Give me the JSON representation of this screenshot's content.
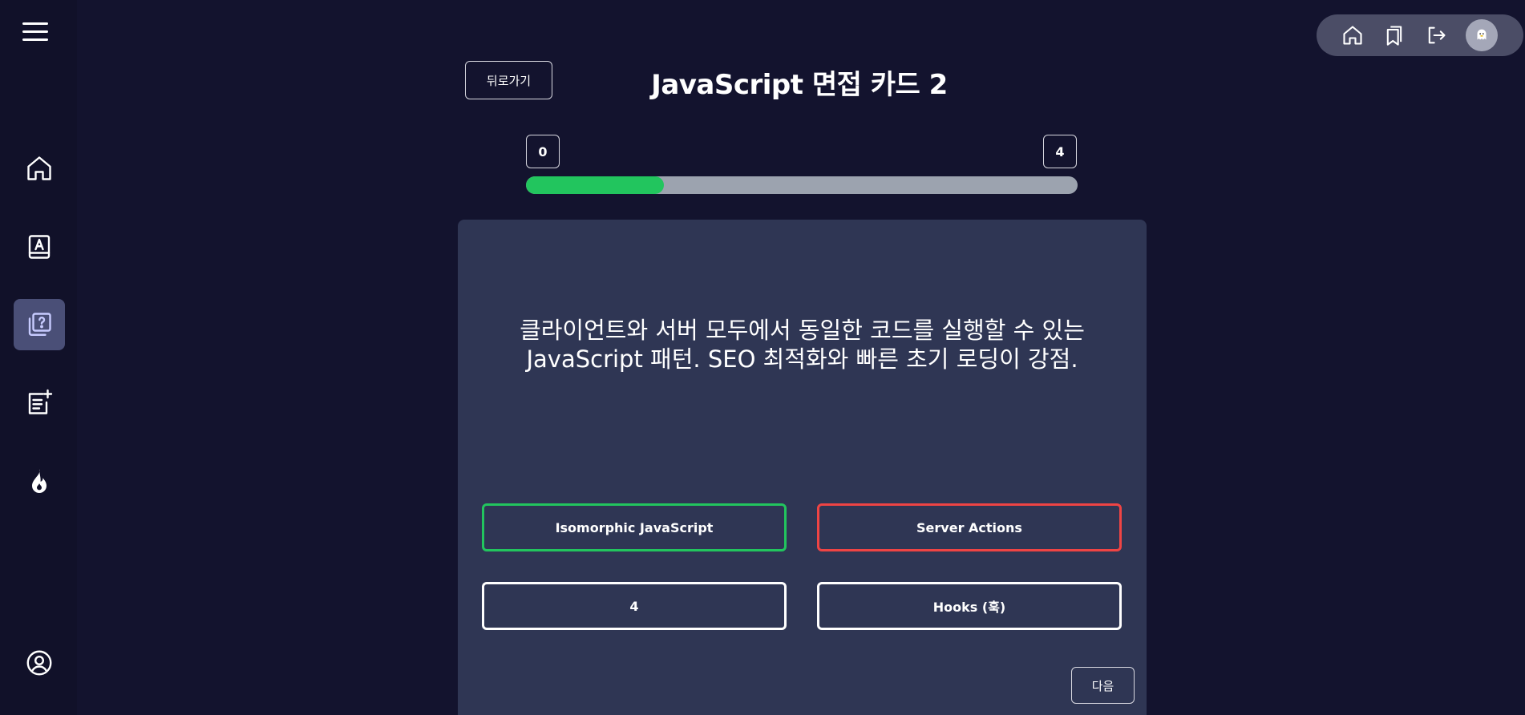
{
  "sidebar": {
    "items": [
      {
        "name": "home",
        "icon": "home-icon",
        "active": false
      },
      {
        "name": "study-book",
        "icon": "book-letter-icon",
        "active": false
      },
      {
        "name": "quiz-cards",
        "icon": "question-cards-icon",
        "active": true
      },
      {
        "name": "add-note",
        "icon": "note-add-icon",
        "active": false
      },
      {
        "name": "hot",
        "icon": "fire-icon",
        "active": false
      }
    ],
    "profile_icon": "user-circle-icon"
  },
  "topbar": {
    "icons": [
      "home-icon",
      "bookmarks-icon",
      "logout-icon"
    ],
    "avatar_icon": "ghost-avatar-icon"
  },
  "header": {
    "back_label": "뒤로가기",
    "title": "JavaScript 면접 카드 2"
  },
  "progress": {
    "min_label": "0",
    "max_label": "4",
    "fraction": 0.25,
    "fill_color": "#22c55e",
    "track_color": "#9ca3af"
  },
  "card": {
    "question": "클라이언트와 서버 모두에서 동일한 코드를 실행할 수 있는 JavaScript 패턴. SEO 최적화와 빠른 초기 로딩이 강점.",
    "options": [
      {
        "label": "Isomorphic JavaScript",
        "state": "correct"
      },
      {
        "label": "Server Actions",
        "state": "wrong"
      },
      {
        "label": "4",
        "state": "neutral"
      },
      {
        "label": "Hooks (훅)",
        "state": "neutral"
      }
    ],
    "next_label": "다음"
  },
  "colors": {
    "background": "#13132e",
    "card": "#2f3654",
    "correct": "#22c55e",
    "wrong": "#ef4444",
    "active_nav": "#4a4f77"
  }
}
